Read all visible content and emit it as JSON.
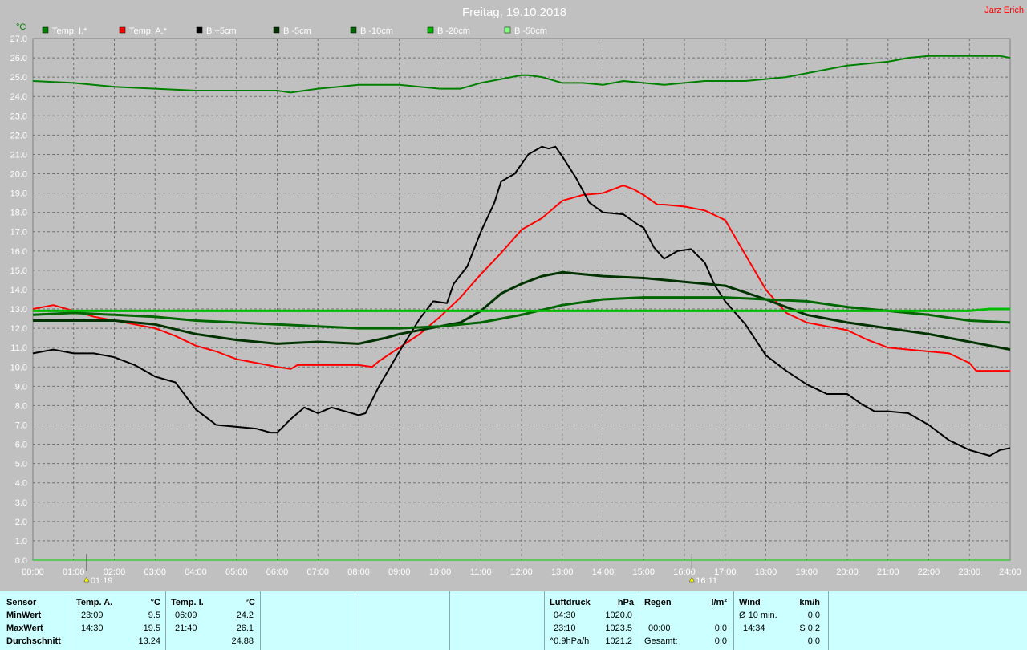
{
  "title": "Freitag, 19.10.2018",
  "user": "Jarz Erich",
  "unit_label": "°C",
  "chart_data": {
    "type": "line",
    "title": "Freitag, 19.10.2018",
    "ylabel": "°C",
    "ylim": [
      0,
      27
    ],
    "xlim": [
      "00:00",
      "24:00"
    ],
    "grid": true,
    "legend_position": "top",
    "y_ticks": [
      "0.0",
      "1.0",
      "2.0",
      "3.0",
      "4.0",
      "5.0",
      "6.0",
      "7.0",
      "8.0",
      "9.0",
      "10.0",
      "11.0",
      "12.0",
      "13.0",
      "14.0",
      "15.0",
      "16.0",
      "17.0",
      "18.0",
      "19.0",
      "20.0",
      "21.0",
      "22.0",
      "23.0",
      "24.0",
      "25.0",
      "26.0",
      "27.0"
    ],
    "x_ticks": [
      "00:00",
      "01:00",
      "02:00",
      "03:00",
      "04:00",
      "05:00",
      "06:00",
      "07:00",
      "08:00",
      "09:00",
      "10:00",
      "11:00",
      "12:00",
      "13:00",
      "14:00",
      "15:00",
      "16:00",
      "17:00",
      "18:00",
      "19:00",
      "20:00",
      "21:00",
      "22:00",
      "23:00",
      "24:00"
    ],
    "markers": [
      {
        "time": "01:19",
        "label": "01:19"
      },
      {
        "time": "16:11",
        "label": "16:11"
      }
    ],
    "series": [
      {
        "name": "Temp. I.*",
        "color": "#008000",
        "stroke_width": 2,
        "points": [
          [
            "00:00",
            24.8
          ],
          [
            "01:00",
            24.7
          ],
          [
            "02:00",
            24.5
          ],
          [
            "03:00",
            24.4
          ],
          [
            "04:00",
            24.3
          ],
          [
            "05:00",
            24.3
          ],
          [
            "06:00",
            24.3
          ],
          [
            "06:20",
            24.2
          ],
          [
            "07:00",
            24.4
          ],
          [
            "07:30",
            24.5
          ],
          [
            "08:00",
            24.6
          ],
          [
            "09:00",
            24.6
          ],
          [
            "09:30",
            24.5
          ],
          [
            "10:00",
            24.4
          ],
          [
            "10:30",
            24.4
          ],
          [
            "11:00",
            24.7
          ],
          [
            "11:30",
            24.9
          ],
          [
            "12:00",
            25.1
          ],
          [
            "12:10",
            25.1
          ],
          [
            "12:30",
            25.0
          ],
          [
            "13:00",
            24.7
          ],
          [
            "13:30",
            24.7
          ],
          [
            "14:00",
            24.6
          ],
          [
            "14:30",
            24.8
          ],
          [
            "15:00",
            24.7
          ],
          [
            "15:30",
            24.6
          ],
          [
            "16:00",
            24.7
          ],
          [
            "16:30",
            24.8
          ],
          [
            "17:00",
            24.8
          ],
          [
            "17:30",
            24.8
          ],
          [
            "18:00",
            24.9
          ],
          [
            "18:30",
            25.0
          ],
          [
            "19:00",
            25.2
          ],
          [
            "19:30",
            25.4
          ],
          [
            "20:00",
            25.6
          ],
          [
            "20:30",
            25.7
          ],
          [
            "21:00",
            25.8
          ],
          [
            "21:30",
            26.0
          ],
          [
            "22:00",
            26.1
          ],
          [
            "23:00",
            26.1
          ],
          [
            "23:45",
            26.1
          ],
          [
            "24:00",
            26.0
          ]
        ]
      },
      {
        "name": "Temp. A.*",
        "color": "#ff0000",
        "stroke_width": 2,
        "points": [
          [
            "00:00",
            13.0
          ],
          [
            "00:30",
            13.2
          ],
          [
            "01:00",
            12.9
          ],
          [
            "01:30",
            12.6
          ],
          [
            "02:00",
            12.4
          ],
          [
            "02:30",
            12.2
          ],
          [
            "03:00",
            12.0
          ],
          [
            "03:30",
            11.6
          ],
          [
            "04:00",
            11.1
          ],
          [
            "04:30",
            10.8
          ],
          [
            "05:00",
            10.4
          ],
          [
            "05:30",
            10.2
          ],
          [
            "06:00",
            10.0
          ],
          [
            "06:20",
            9.9
          ],
          [
            "06:30",
            10.1
          ],
          [
            "07:00",
            10.1
          ],
          [
            "07:30",
            10.1
          ],
          [
            "08:00",
            10.1
          ],
          [
            "08:20",
            10.0
          ],
          [
            "08:30",
            10.3
          ],
          [
            "09:00",
            11.0
          ],
          [
            "09:30",
            11.7
          ],
          [
            "10:00",
            12.6
          ],
          [
            "10:30",
            13.6
          ],
          [
            "11:00",
            14.8
          ],
          [
            "11:30",
            15.9
          ],
          [
            "12:00",
            17.1
          ],
          [
            "12:20",
            17.5
          ],
          [
            "12:30",
            17.7
          ],
          [
            "13:00",
            18.6
          ],
          [
            "13:30",
            18.9
          ],
          [
            "14:00",
            19.0
          ],
          [
            "14:30",
            19.4
          ],
          [
            "14:45",
            19.2
          ],
          [
            "15:00",
            18.9
          ],
          [
            "15:20",
            18.4
          ],
          [
            "15:30",
            18.4
          ],
          [
            "16:00",
            18.3
          ],
          [
            "16:30",
            18.1
          ],
          [
            "17:00",
            17.6
          ],
          [
            "17:30",
            15.8
          ],
          [
            "18:00",
            14.0
          ],
          [
            "18:30",
            12.8
          ],
          [
            "19:00",
            12.3
          ],
          [
            "19:30",
            12.1
          ],
          [
            "20:00",
            11.9
          ],
          [
            "20:30",
            11.4
          ],
          [
            "21:00",
            11.0
          ],
          [
            "21:30",
            10.9
          ],
          [
            "22:00",
            10.8
          ],
          [
            "22:30",
            10.7
          ],
          [
            "23:00",
            10.2
          ],
          [
            "23:10",
            9.8
          ],
          [
            "23:30",
            9.8
          ],
          [
            "24:00",
            9.8
          ]
        ]
      },
      {
        "name": "B +5cm",
        "color": "#000000",
        "stroke_width": 2,
        "points": [
          [
            "00:00",
            10.7
          ],
          [
            "00:30",
            10.9
          ],
          [
            "01:00",
            10.7
          ],
          [
            "01:30",
            10.7
          ],
          [
            "02:00",
            10.5
          ],
          [
            "02:30",
            10.1
          ],
          [
            "03:00",
            9.5
          ],
          [
            "03:30",
            9.2
          ],
          [
            "04:00",
            7.8
          ],
          [
            "04:30",
            7.0
          ],
          [
            "05:00",
            6.9
          ],
          [
            "05:30",
            6.8
          ],
          [
            "05:50",
            6.6
          ],
          [
            "06:00",
            6.6
          ],
          [
            "06:20",
            7.3
          ],
          [
            "06:40",
            7.9
          ],
          [
            "07:00",
            7.6
          ],
          [
            "07:20",
            7.9
          ],
          [
            "07:40",
            7.7
          ],
          [
            "08:00",
            7.5
          ],
          [
            "08:10",
            7.6
          ],
          [
            "08:30",
            9.0
          ],
          [
            "09:00",
            10.8
          ],
          [
            "09:30",
            12.5
          ],
          [
            "09:50",
            13.4
          ],
          [
            "10:10",
            13.3
          ],
          [
            "10:20",
            14.3
          ],
          [
            "10:40",
            15.2
          ],
          [
            "11:00",
            17.0
          ],
          [
            "11:20",
            18.5
          ],
          [
            "11:30",
            19.6
          ],
          [
            "11:50",
            20.0
          ],
          [
            "12:10",
            21.0
          ],
          [
            "12:30",
            21.4
          ],
          [
            "12:40",
            21.3
          ],
          [
            "12:50",
            21.4
          ],
          [
            "13:00",
            20.9
          ],
          [
            "13:20",
            19.8
          ],
          [
            "13:40",
            18.5
          ],
          [
            "14:00",
            18.0
          ],
          [
            "14:30",
            17.9
          ],
          [
            "14:50",
            17.4
          ],
          [
            "15:00",
            17.2
          ],
          [
            "15:15",
            16.2
          ],
          [
            "15:30",
            15.6
          ],
          [
            "15:50",
            16.0
          ],
          [
            "16:10",
            16.1
          ],
          [
            "16:30",
            15.4
          ],
          [
            "16:45",
            14.2
          ],
          [
            "17:00",
            13.4
          ],
          [
            "17:30",
            12.2
          ],
          [
            "18:00",
            10.6
          ],
          [
            "18:30",
            9.8
          ],
          [
            "19:00",
            9.1
          ],
          [
            "19:30",
            8.6
          ],
          [
            "20:00",
            8.6
          ],
          [
            "20:20",
            8.1
          ],
          [
            "20:40",
            7.7
          ],
          [
            "21:00",
            7.7
          ],
          [
            "21:30",
            7.6
          ],
          [
            "22:00",
            7.0
          ],
          [
            "22:30",
            6.2
          ],
          [
            "23:00",
            5.7
          ],
          [
            "23:30",
            5.4
          ],
          [
            "23:45",
            5.7
          ],
          [
            "24:00",
            5.8
          ]
        ]
      },
      {
        "name": "B -5cm",
        "color": "#003300",
        "stroke_width": 3,
        "points": [
          [
            "00:00",
            12.4
          ],
          [
            "02:00",
            12.4
          ],
          [
            "03:00",
            12.2
          ],
          [
            "04:00",
            11.7
          ],
          [
            "05:00",
            11.4
          ],
          [
            "06:00",
            11.2
          ],
          [
            "07:00",
            11.3
          ],
          [
            "08:00",
            11.2
          ],
          [
            "08:40",
            11.5
          ],
          [
            "09:00",
            11.7
          ],
          [
            "10:00",
            12.1
          ],
          [
            "10:30",
            12.3
          ],
          [
            "11:00",
            12.9
          ],
          [
            "11:30",
            13.8
          ],
          [
            "12:00",
            14.3
          ],
          [
            "12:30",
            14.7
          ],
          [
            "13:00",
            14.9
          ],
          [
            "14:00",
            14.7
          ],
          [
            "15:00",
            14.6
          ],
          [
            "16:00",
            14.4
          ],
          [
            "17:00",
            14.2
          ],
          [
            "18:00",
            13.5
          ],
          [
            "19:00",
            12.7
          ],
          [
            "20:00",
            12.3
          ],
          [
            "21:00",
            12.0
          ],
          [
            "22:00",
            11.7
          ],
          [
            "23:00",
            11.3
          ],
          [
            "23:30",
            11.1
          ],
          [
            "24:00",
            10.9
          ]
        ]
      },
      {
        "name": "B -10cm",
        "color": "#006600",
        "stroke_width": 3,
        "points": [
          [
            "00:00",
            12.7
          ],
          [
            "01:00",
            12.8
          ],
          [
            "02:00",
            12.7
          ],
          [
            "03:00",
            12.6
          ],
          [
            "04:00",
            12.4
          ],
          [
            "05:00",
            12.3
          ],
          [
            "06:00",
            12.2
          ],
          [
            "07:00",
            12.1
          ],
          [
            "08:00",
            12.0
          ],
          [
            "09:00",
            12.0
          ],
          [
            "10:00",
            12.1
          ],
          [
            "11:00",
            12.3
          ],
          [
            "12:00",
            12.7
          ],
          [
            "13:00",
            13.2
          ],
          [
            "14:00",
            13.5
          ],
          [
            "15:00",
            13.6
          ],
          [
            "16:00",
            13.6
          ],
          [
            "17:00",
            13.6
          ],
          [
            "18:00",
            13.5
          ],
          [
            "19:00",
            13.4
          ],
          [
            "20:00",
            13.1
          ],
          [
            "21:00",
            12.9
          ],
          [
            "22:00",
            12.7
          ],
          [
            "23:00",
            12.4
          ],
          [
            "24:00",
            12.3
          ]
        ]
      },
      {
        "name": "B -20cm",
        "color": "#00bb00",
        "stroke_width": 3,
        "points": [
          [
            "00:00",
            12.9
          ],
          [
            "04:00",
            12.9
          ],
          [
            "08:00",
            12.9
          ],
          [
            "12:00",
            12.9
          ],
          [
            "16:00",
            12.9
          ],
          [
            "20:00",
            12.9
          ],
          [
            "23:00",
            12.9
          ],
          [
            "23:30",
            13.0
          ],
          [
            "24:00",
            13.0
          ]
        ]
      },
      {
        "name": "B -50cm",
        "color": "#80ff80",
        "stroke_width": 2,
        "points": []
      }
    ]
  },
  "table": {
    "row_labels": [
      "Sensor",
      "MinWert",
      "MaxWert",
      "Durchschnitt"
    ],
    "temp_a": {
      "header": "Temp. A.",
      "unit": "°C",
      "min_time": "23:09",
      "min_val": "9.5",
      "max_time": "14:30",
      "max_val": "19.5",
      "avg": "13.24"
    },
    "temp_i": {
      "header": "Temp. I.",
      "unit": "°C",
      "min_time": "06:09",
      "min_val": "24.2",
      "max_time": "21:40",
      "max_val": "26.1",
      "avg": "24.88"
    },
    "pressure": {
      "header": "Luftdruck",
      "unit": "hPa",
      "min_time": "04:30",
      "min_val": "1020.0",
      "max_time": "23:10",
      "max_val": "1023.5",
      "trend_label": "^0.9hPa/h",
      "trend_val": "1021.2"
    },
    "rain": {
      "header": "Regen",
      "unit": "l/m²",
      "time": "00:00",
      "val": "0.0",
      "total_label": "Gesamt:",
      "total_val": "0.0"
    },
    "wind": {
      "header": "Wind",
      "unit": "km/h",
      "avg_label": "Ø 10 min.",
      "avg_val": "0.0",
      "time": "14:34",
      "dir_val": "S 0.2",
      "last_val": "0.0"
    }
  }
}
